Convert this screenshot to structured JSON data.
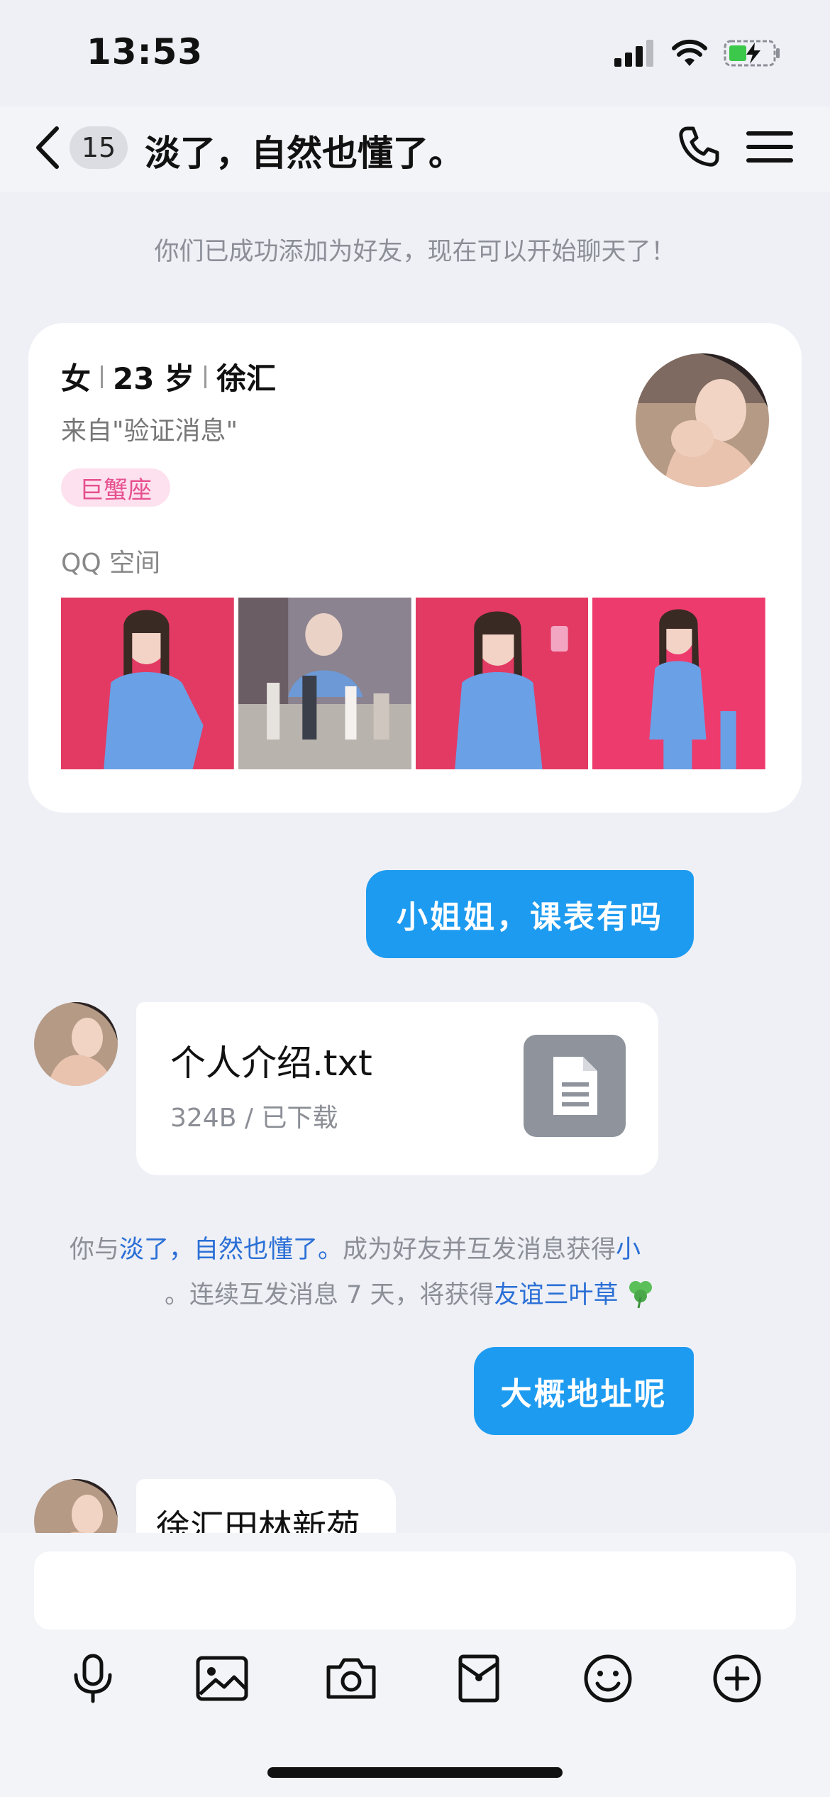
{
  "status_bar": {
    "time": "13:53",
    "icons": [
      "cellular-signal-icon",
      "wifi-icon",
      "battery-charging-icon"
    ]
  },
  "nav": {
    "back_icon": "chevron-left-icon",
    "unread_count": "15",
    "title": "淡了，自然也懂了。",
    "call_icon": "phone-icon",
    "menu_icon": "menu-icon"
  },
  "system_message": "你们已成功添加为好友，现在可以开始聊天了！",
  "profile_card": {
    "gender": "女",
    "age": "23 岁",
    "location": "徐汇",
    "source": "来自\"验证消息\"",
    "zodiac_tag": "巨蟹座",
    "qzone_label": "QQ 空间",
    "photos": [
      "qzone-photo-1",
      "qzone-photo-2",
      "qzone-photo-3",
      "qzone-photo-4"
    ]
  },
  "messages": {
    "out1": "小姐姐，课表有吗",
    "file_name": "个人介绍.txt",
    "file_meta": "324B / 已下载",
    "file_icon": "document-icon",
    "notice_line1_pre": "你与",
    "notice_line1_link": "淡了，自然也懂了。",
    "notice_line1_mid": "成为好友并互发消息获得",
    "notice_line1_link2": "小",
    "notice_line2_pre": "。连续互发消息 7 天，将获得",
    "notice_line2_link": "友谊三叶草",
    "notice_line2_icon": "clover-icon",
    "out2": "大概地址呢",
    "in2": "徐汇田林新苑"
  },
  "toolbar": [
    "microphone-icon",
    "image-icon",
    "camera-icon",
    "red-packet-icon",
    "emoji-icon",
    "plus-icon"
  ],
  "colors": {
    "accent": "#1d9bf0",
    "link": "#2b6fd6",
    "tag_bg": "#fde1ef",
    "tag_text": "#e6508f",
    "background": "#eef0f5"
  }
}
